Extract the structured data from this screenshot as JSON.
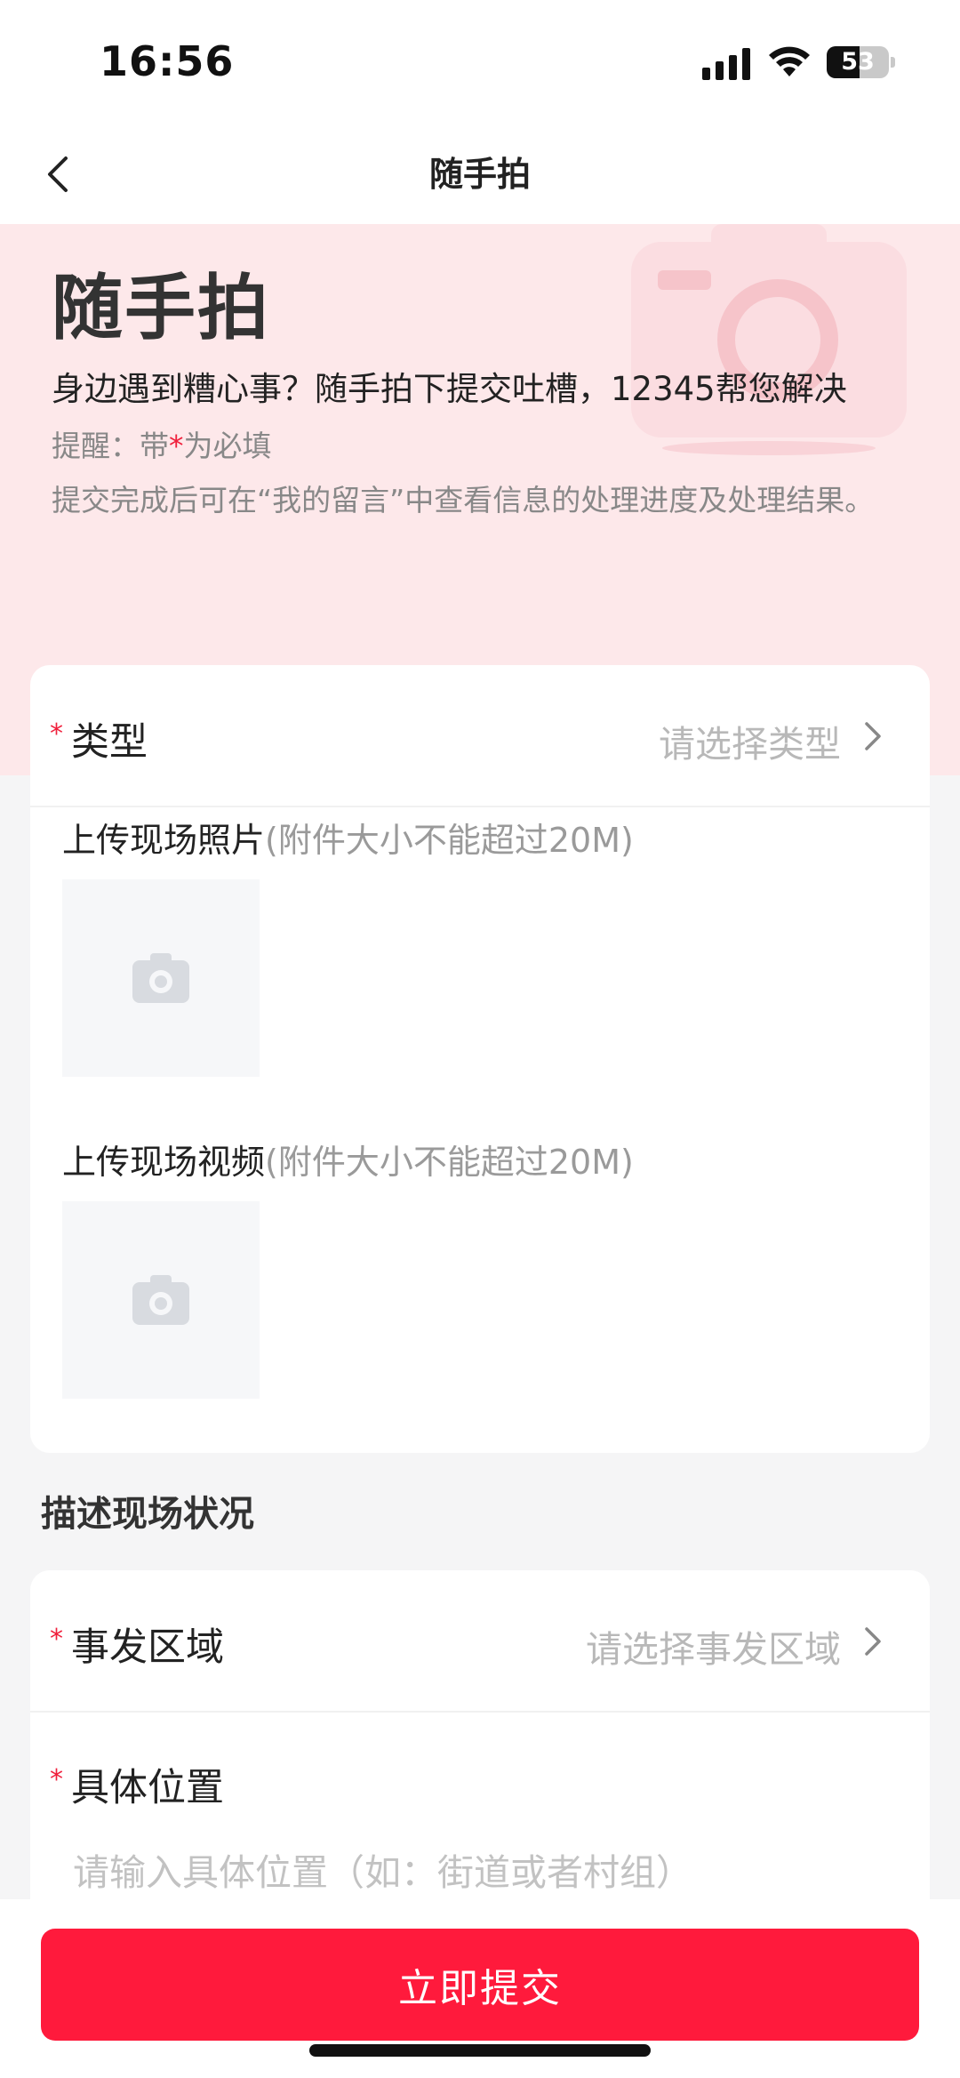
{
  "status_bar": {
    "time": "16:56",
    "battery_level": "53",
    "battery_fraction": 0.53,
    "icons": [
      "signal-icon",
      "wifi-icon",
      "battery-icon"
    ]
  },
  "nav": {
    "title": "随手拍",
    "back_icon": "chevron-left-icon"
  },
  "hero": {
    "title": "随手拍",
    "subtitle": "身边遇到糟心事？随手拍下提交吐槽，12345帮您解决",
    "reminder_prefix": "提醒：带",
    "required_mark": "*",
    "reminder_suffix": "为必填",
    "note": "提交完成后可在“我的留言”中查看信息的处理进度及处理结果。"
  },
  "form": {
    "required_mark": "*",
    "type": {
      "label": "类型",
      "placeholder": "请选择类型"
    },
    "photo_upload": {
      "label": "上传现场照片",
      "hint": "(附件大小不能超过20M)"
    },
    "video_upload": {
      "label": "上传现场视频",
      "hint": "(附件大小不能超过20M)"
    },
    "section_title": "描述现场状况",
    "area": {
      "label": "事发区域",
      "placeholder": "请选择事发区域"
    },
    "location": {
      "label": "具体位置",
      "placeholder": "请输入具体位置（如：街道或者村组）"
    }
  },
  "submit": {
    "label": "立即提交"
  },
  "colors": {
    "accent": "#ff1a3c",
    "required": "#f0203c",
    "hero_bg": "#fde8ea"
  }
}
